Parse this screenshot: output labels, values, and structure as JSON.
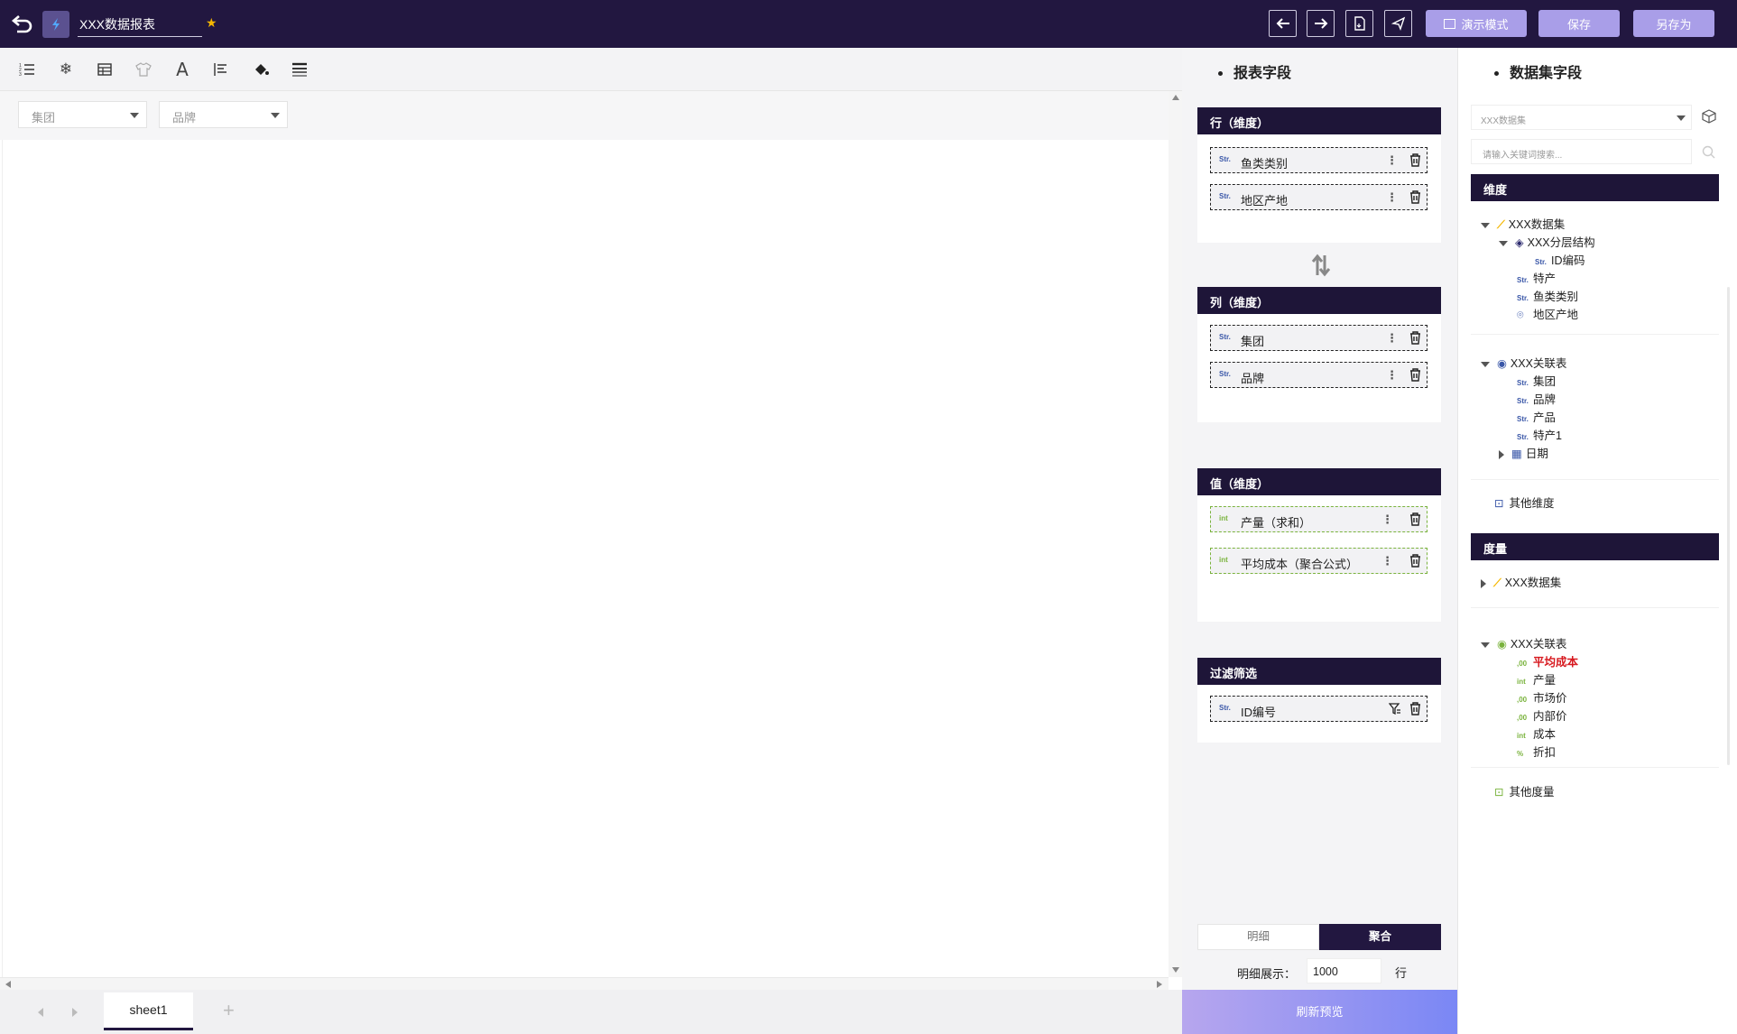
{
  "header": {
    "title": "XXX数据报表",
    "present_label": "演示模式",
    "save_label": "保存",
    "save_as_label": "另存为"
  },
  "filters": [
    {
      "placeholder": "集团"
    },
    {
      "placeholder": "品牌"
    }
  ],
  "sheets": {
    "tabs": [
      "sheet1"
    ]
  },
  "report_fields": {
    "title": "报表字段",
    "rows": {
      "label": "行（维度）",
      "items": [
        {
          "type": "Str.",
          "name": "鱼类类别"
        },
        {
          "type": "Str.",
          "name": "地区产地"
        }
      ]
    },
    "cols": {
      "label": "列（维度）",
      "items": [
        {
          "type": "Str.",
          "name": "集团"
        },
        {
          "type": "Str.",
          "name": "品牌"
        }
      ]
    },
    "values": {
      "label": "值（维度）",
      "items": [
        {
          "type": "int",
          "name": "产量（求和）"
        },
        {
          "type": "int",
          "name": "平均成本（聚合公式）"
        }
      ]
    },
    "filter": {
      "label": "过滤筛选",
      "items": [
        {
          "type": "Str.",
          "name": "ID编号"
        }
      ]
    },
    "mode_tabs": [
      "明细",
      "聚合"
    ],
    "active_mode": "聚合",
    "detail_label": "明细展示：",
    "detail_value": "1000",
    "detail_unit": "行",
    "refresh_label": "刷新预览"
  },
  "dataset": {
    "title": "数据集字段",
    "select_value": "XXX数据集",
    "search_placeholder": "请输入关键词搜索...",
    "dims_label": "维度",
    "dims": {
      "group1": "XXX数据集",
      "hier": "XXX分层结构",
      "hier_items": [
        "ID编码"
      ],
      "g1_items": [
        "特产",
        "鱼类类别",
        "地区产地"
      ],
      "group2": "XXX关联表",
      "g2_items": [
        "集团",
        "品牌",
        "产品",
        "特产1"
      ],
      "g2_date": "日期",
      "other": "其他维度"
    },
    "measures_label": "度量",
    "measures": {
      "group1": "XXX数据集",
      "group2": "XXX关联表",
      "items": [
        {
          "type": "calc",
          "name": "平均成本",
          "highlight": true
        },
        {
          "type": "int",
          "name": "产量"
        },
        {
          "type": "calc",
          "name": "市场价"
        },
        {
          "type": "calc",
          "name": "内部价"
        },
        {
          "type": "int",
          "name": "成本"
        },
        {
          "type": "pct",
          "name": "折扣"
        }
      ],
      "other": "其他度量"
    }
  },
  "type_labels": {
    "str": "Str.",
    "int": "int",
    "pct": "%"
  },
  "colors": {
    "primary": "#221740",
    "accent": "#a99ee8",
    "highlight": "#d7191f",
    "int_green": "#7ab33d",
    "str_blue": "#3a57a8",
    "star": "#f5b700"
  }
}
